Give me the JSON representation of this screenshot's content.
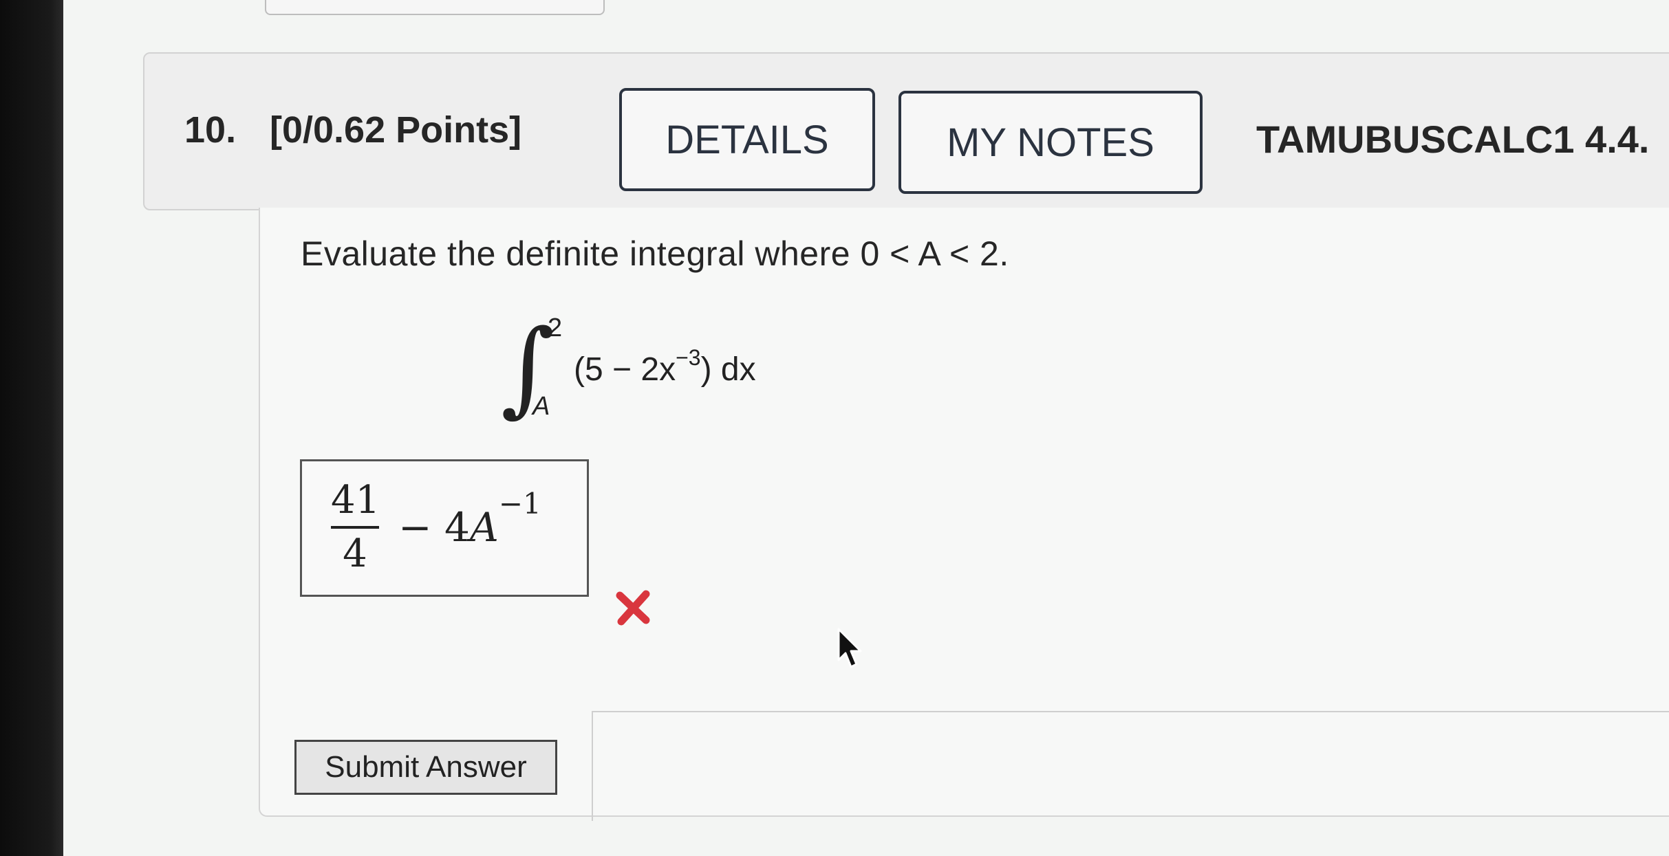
{
  "question": {
    "number": "10.",
    "points": "[0/0.62 Points]",
    "details_label": "DETAILS",
    "notes_label": "MY NOTES",
    "course_code": "TAMUBUSCALC1 4.4."
  },
  "problem": {
    "prompt": "Evaluate the definite integral where 0 < A < 2.",
    "integral_sign": "∫",
    "upper_limit": "2",
    "lower_limit": "A",
    "integrand_pre": "(5 − 2x",
    "integrand_exp": "−3",
    "integrand_post": ") dx"
  },
  "answer": {
    "numerator": "41",
    "denominator": "4",
    "minus_coef": "− 4",
    "variable": "A",
    "exponent": "−1",
    "status": "incorrect",
    "status_color": "#d9363e"
  },
  "actions": {
    "submit_label": "Submit Answer"
  },
  "icons": {
    "status_icon": "x-mark-icon",
    "pointer": "mouse-cursor-icon"
  }
}
